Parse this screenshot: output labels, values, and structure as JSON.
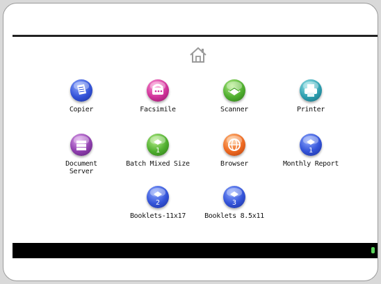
{
  "home": {
    "icon": "home-icon"
  },
  "apps": [
    {
      "id": "copier",
      "label": "Copier",
      "icon": "copier-icon",
      "color": "blue",
      "badge": ""
    },
    {
      "id": "facsimile",
      "label": "Facsimile",
      "icon": "fax-icon",
      "color": "pink",
      "badge": ""
    },
    {
      "id": "scanner",
      "label": "Scanner",
      "icon": "scanner-icon",
      "color": "green",
      "badge": ""
    },
    {
      "id": "printer",
      "label": "Printer",
      "icon": "printer-icon",
      "color": "teal",
      "badge": ""
    },
    {
      "id": "document-server",
      "label": "Document\nServer",
      "icon": "document-server-icon",
      "color": "purple",
      "badge": ""
    },
    {
      "id": "batch-mixed-size",
      "label": "Batch Mixed Size",
      "icon": "program-icon",
      "color": "green",
      "badge": "1"
    },
    {
      "id": "browser",
      "label": "Browser",
      "icon": "globe-icon",
      "color": "orange",
      "badge": ""
    },
    {
      "id": "monthly-report",
      "label": "Monthly Report",
      "icon": "program-icon",
      "color": "blue",
      "badge": "1"
    },
    {
      "id": "booklets-11x17",
      "label": "Booklets-11x17",
      "icon": "program-icon",
      "color": "blue",
      "badge": "2"
    },
    {
      "id": "booklets-8-5x11",
      "label": "Booklets 8.5x11",
      "icon": "program-icon",
      "color": "blue",
      "badge": "3"
    }
  ]
}
